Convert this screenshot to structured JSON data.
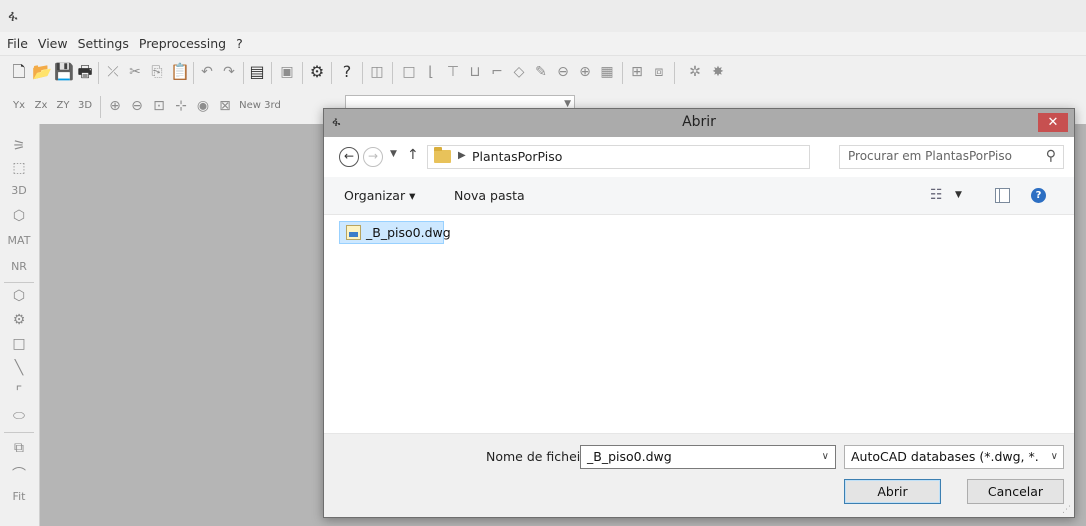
{
  "app": {
    "logo_glyph": "ፋ",
    "menu": [
      "File",
      "View",
      "Settings",
      "Preprocessing",
      "?"
    ]
  },
  "toolbar1": {
    "buttons": [
      "new-icon",
      "open-icon",
      "save-icon",
      "print-icon",
      "scissors-icon",
      "cut-icon",
      "copy-icon",
      "paste-icon",
      "undo-icon",
      "redo-icon",
      "preview-icon",
      "layers-icon",
      "tools-icon",
      "help-icon",
      "panel-icon",
      "rect-icon",
      "l-shape-icon",
      "t-shape-icon",
      "u-shape-icon",
      "step-icon",
      "pen-icon",
      "pencil-icon",
      "circle-icon",
      "crosshair-icon",
      "table-icon",
      "grid-icon",
      "3d-icon",
      "gear-icon",
      "settings-icon"
    ]
  },
  "toolbar2": {
    "labels": [
      "Yx",
      "Zx",
      "ZY",
      "3D",
      "New 3rd"
    ],
    "combo_value": ""
  },
  "vtoolbar": {
    "text_items": [
      "3D",
      "MAT",
      "NR",
      "Fit"
    ]
  },
  "dialog": {
    "title": "Abrir",
    "close_glyph": "✕",
    "address": {
      "path": "PlantasPorPiso"
    },
    "search": {
      "placeholder": "Procurar em PlantasPorPiso"
    },
    "commands": {
      "organize": "Organizar ▾",
      "new_folder": "Nova pasta"
    },
    "files": [
      {
        "name": "_B_piso0.dwg",
        "selected": true
      }
    ],
    "filename": {
      "label": "Nome de ficheiro:",
      "value": "_B_piso0.dwg"
    },
    "filetype": {
      "value": "AutoCAD databases (*.dwg, *.d"
    },
    "buttons": {
      "open": "Abrir",
      "cancel": "Cancelar"
    }
  },
  "colors": {
    "workspace": "#b5b5b5",
    "dialog_titlebar": "#ababab",
    "close_button": "#c75050",
    "selection": "#cde8ff"
  }
}
